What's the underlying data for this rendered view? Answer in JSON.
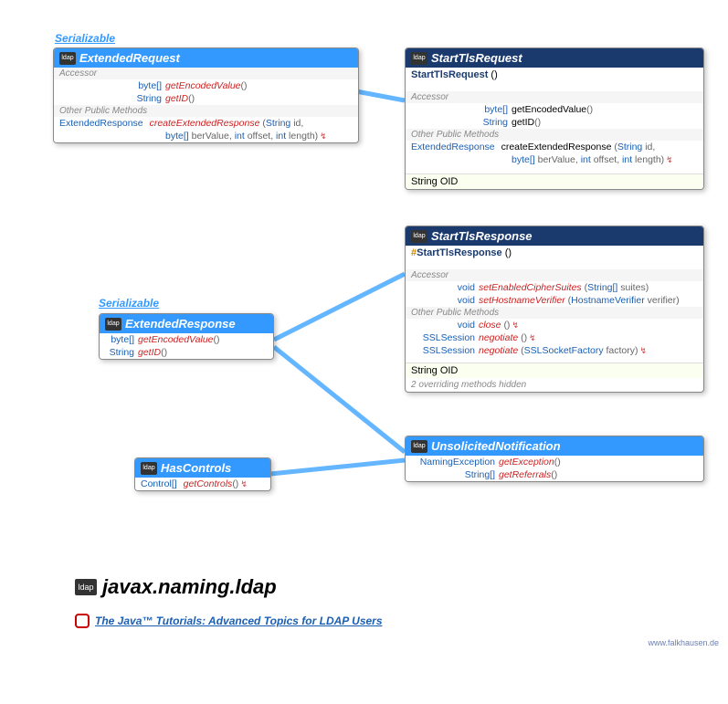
{
  "serializable1": "Serializable",
  "serializable2": "Serializable",
  "package": "javax.naming.ldap",
  "tutorial": "The Java™ Tutorials: Advanced Topics for LDAP Users",
  "credit": "www.falkhausen.de",
  "icon_label": "ldap",
  "boxes": {
    "extendedRequest": {
      "title": "ExtendedRequest",
      "sections": [
        {
          "label": "Accessor",
          "members": [
            {
              "ret": "byte[]",
              "name": "getEncodedValue",
              "params": "()"
            },
            {
              "ret": "String",
              "name": "getID",
              "params": "()"
            }
          ]
        },
        {
          "label": "Other Public Methods",
          "members": [
            {
              "ret": "ExtendedResponse",
              "name": "createExtendedResponse",
              "params": "(String id,",
              "cont": "byte[] berValue, int offset, int length)",
              "throws": true
            }
          ]
        }
      ]
    },
    "startTlsRequest": {
      "title": "StartTlsRequest",
      "constructor": {
        "name": "StartTlsRequest",
        "params": "()"
      },
      "sections": [
        {
          "label": "Accessor",
          "members": [
            {
              "ret": "byte[]",
              "name": "getEncodedValue",
              "params": "()",
              "black": true
            },
            {
              "ret": "String",
              "name": "getID",
              "params": "()",
              "black": true
            }
          ]
        },
        {
          "label": "Other Public Methods",
          "members": [
            {
              "ret": "ExtendedResponse",
              "name": "createExtendedResponse",
              "params": "(String id,",
              "cont": "byte[] berValue, int offset, int length)",
              "throws": true,
              "black": true
            }
          ]
        }
      ],
      "field": {
        "ret": "String",
        "name": "OID"
      }
    },
    "startTlsResponse": {
      "title": "StartTlsResponse",
      "constructor": {
        "prot": "#",
        "name": "StartTlsResponse",
        "params": "()"
      },
      "sections": [
        {
          "label": "Accessor",
          "members": [
            {
              "ret": "void",
              "name": "setEnabledCipherSuites",
              "params": "(String[] suites)"
            },
            {
              "ret": "void",
              "name": "setHostnameVerifier",
              "params": "(HostnameVerifier verifier)"
            }
          ]
        },
        {
          "label": "Other Public Methods",
          "members": [
            {
              "ret": "void",
              "name": "close",
              "params": "()",
              "throws": true
            },
            {
              "ret": "SSLSession",
              "name": "negotiate",
              "params": "()",
              "throws": true
            },
            {
              "ret": "SSLSession",
              "name": "negotiate",
              "params": "(SSLSocketFactory factory)",
              "throws": true
            }
          ]
        }
      ],
      "field": {
        "ret": "String",
        "name": "OID"
      },
      "hidden": "2 overriding methods hidden"
    },
    "extendedResponse": {
      "title": "ExtendedResponse",
      "members": [
        {
          "ret": "byte[]",
          "name": "getEncodedValue",
          "params": "()"
        },
        {
          "ret": "String",
          "name": "getID",
          "params": "()"
        }
      ]
    },
    "unsolicited": {
      "title": "UnsolicitedNotification",
      "members": [
        {
          "ret": "NamingException",
          "name": "getException",
          "params": "()"
        },
        {
          "ret": "String[]",
          "name": "getReferrals",
          "params": "()"
        }
      ]
    },
    "hasControls": {
      "title": "HasControls",
      "members": [
        {
          "ret": "Control[]",
          "name": "getControls",
          "params": "()",
          "throws": true
        }
      ]
    }
  }
}
